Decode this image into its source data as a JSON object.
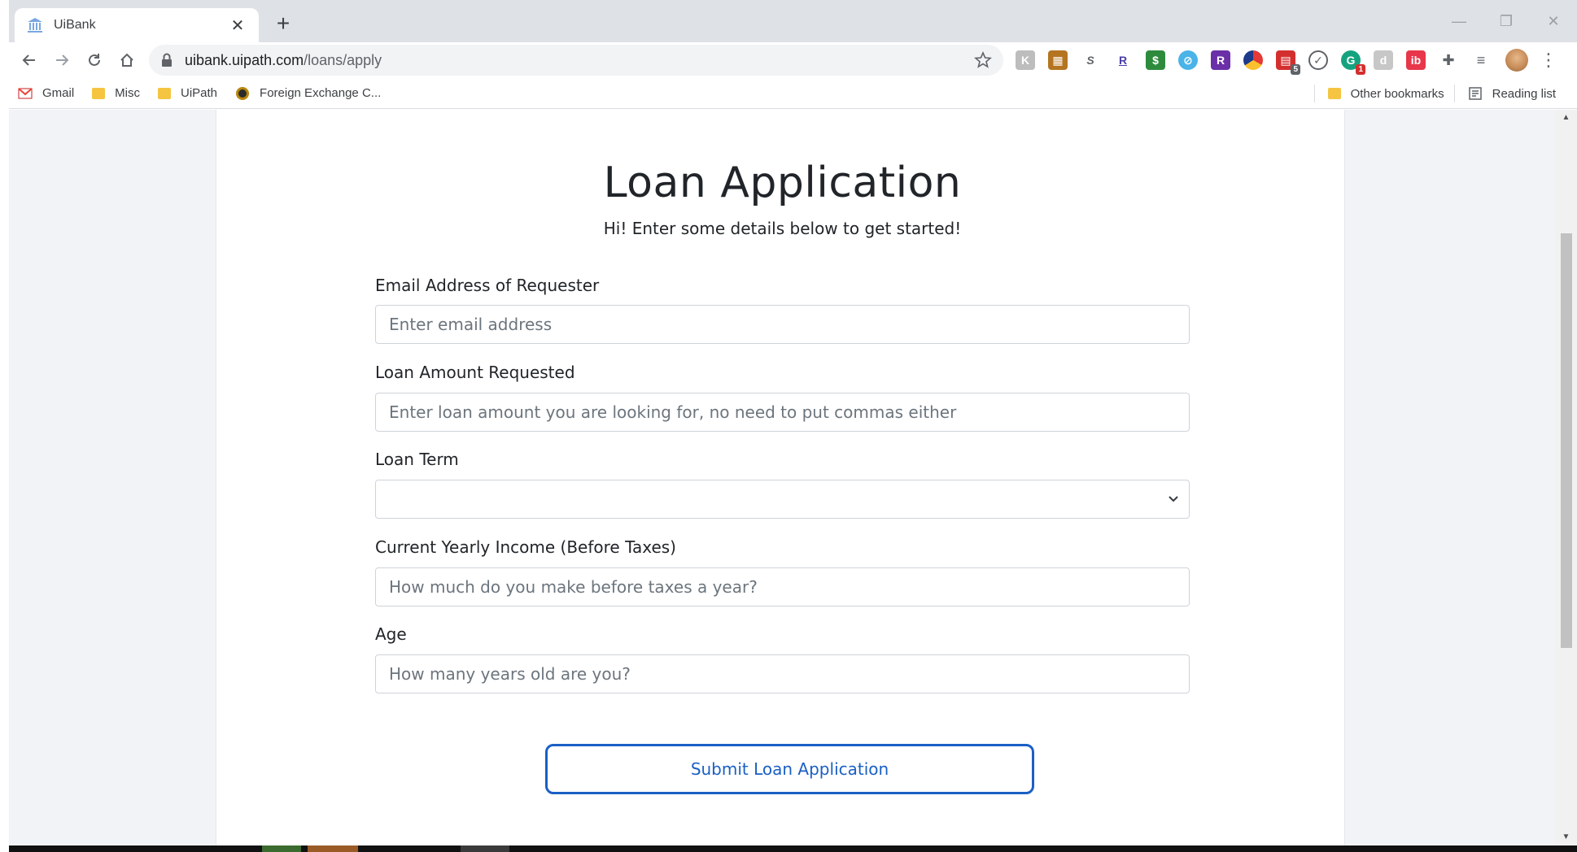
{
  "browser": {
    "tab": {
      "title": "UiBank"
    },
    "url": {
      "host": "uibank.uipath.com",
      "path": "/loans/apply"
    },
    "bookmarks": [
      {
        "label": "Gmail",
        "icon": "gmail-icon"
      },
      {
        "label": "Misc",
        "icon": "folder-icon"
      },
      {
        "label": "UiPath",
        "icon": "folder-icon"
      },
      {
        "label": "Foreign Exchange C...",
        "icon": "globe-icon"
      }
    ],
    "bookmarks_right": {
      "other": "Other bookmarks",
      "reading": "Reading list"
    },
    "extension_badges": {
      "calendar": "5",
      "grammarly": "1"
    }
  },
  "form": {
    "title": "Loan Application",
    "subtitle": "Hi! Enter some details below to get started!",
    "fields": {
      "email": {
        "label": "Email Address of Requester",
        "placeholder": "Enter email address"
      },
      "amount": {
        "label": "Loan Amount Requested",
        "placeholder": "Enter loan amount you are looking for, no need to put commas either"
      },
      "term": {
        "label": "Loan Term",
        "value": ""
      },
      "income": {
        "label": "Current Yearly Income (Before Taxes)",
        "placeholder": "How much do you make before taxes a year?"
      },
      "age": {
        "label": "Age",
        "placeholder": "How many years old are you?"
      }
    },
    "submit_label": "Submit Loan Application"
  },
  "colors": {
    "accent": "#1a5fc4",
    "page_bg": "#f1f3f6",
    "chrome": "#dee1e6"
  }
}
